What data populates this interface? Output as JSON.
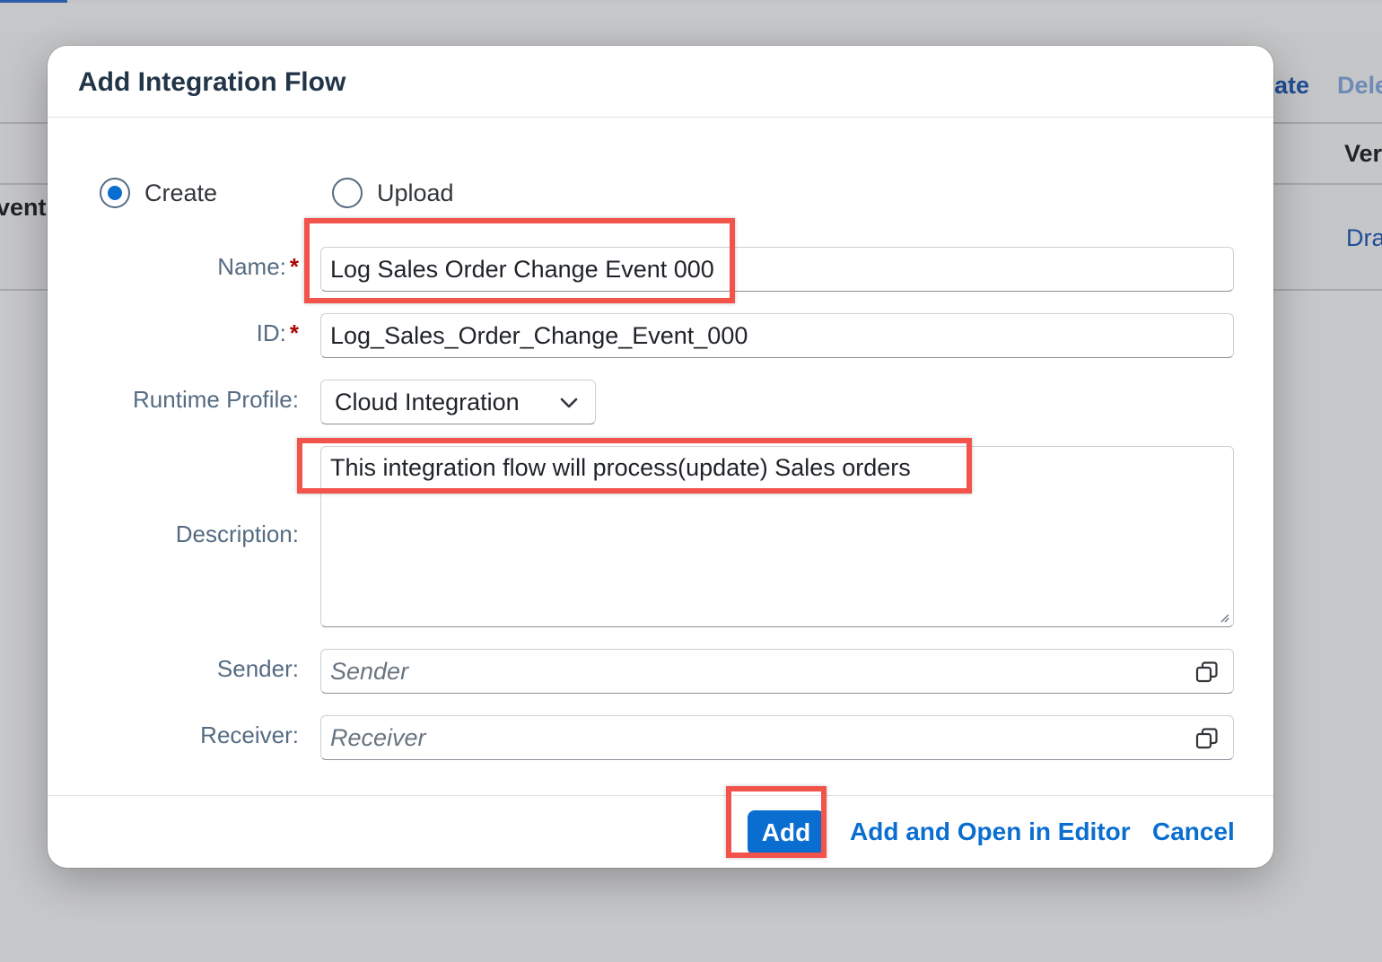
{
  "background": {
    "toolbar_actions": [
      "ate",
      "Dele"
    ],
    "column_header": "Ver",
    "row_left_text": "vent",
    "row_status": "Dra"
  },
  "dialog": {
    "title": "Add Integration Flow",
    "mode_options": [
      {
        "label": "Create",
        "selected": true
      },
      {
        "label": "Upload",
        "selected": false
      }
    ],
    "fields": {
      "name": {
        "label": "Name:",
        "required": true,
        "value": "Log Sales Order Change Event 000"
      },
      "id": {
        "label": "ID:",
        "required": true,
        "value": "Log_Sales_Order_Change_Event_000"
      },
      "runtime_profile": {
        "label": "Runtime Profile:",
        "value": "Cloud Integration"
      },
      "description": {
        "label": "Description:",
        "value": "This integration flow will process(update) Sales orders"
      },
      "sender": {
        "label": "Sender:",
        "placeholder": "Sender",
        "value": ""
      },
      "receiver": {
        "label": "Receiver:",
        "placeholder": "Receiver",
        "value": ""
      }
    },
    "required_marker": "*",
    "footer": {
      "add_label": "Add",
      "add_open_label": "Add and Open in Editor",
      "cancel_label": "Cancel"
    }
  },
  "colors": {
    "accent": "#0a6ed1",
    "highlight": "#f2544b",
    "required": "#aa0808"
  }
}
